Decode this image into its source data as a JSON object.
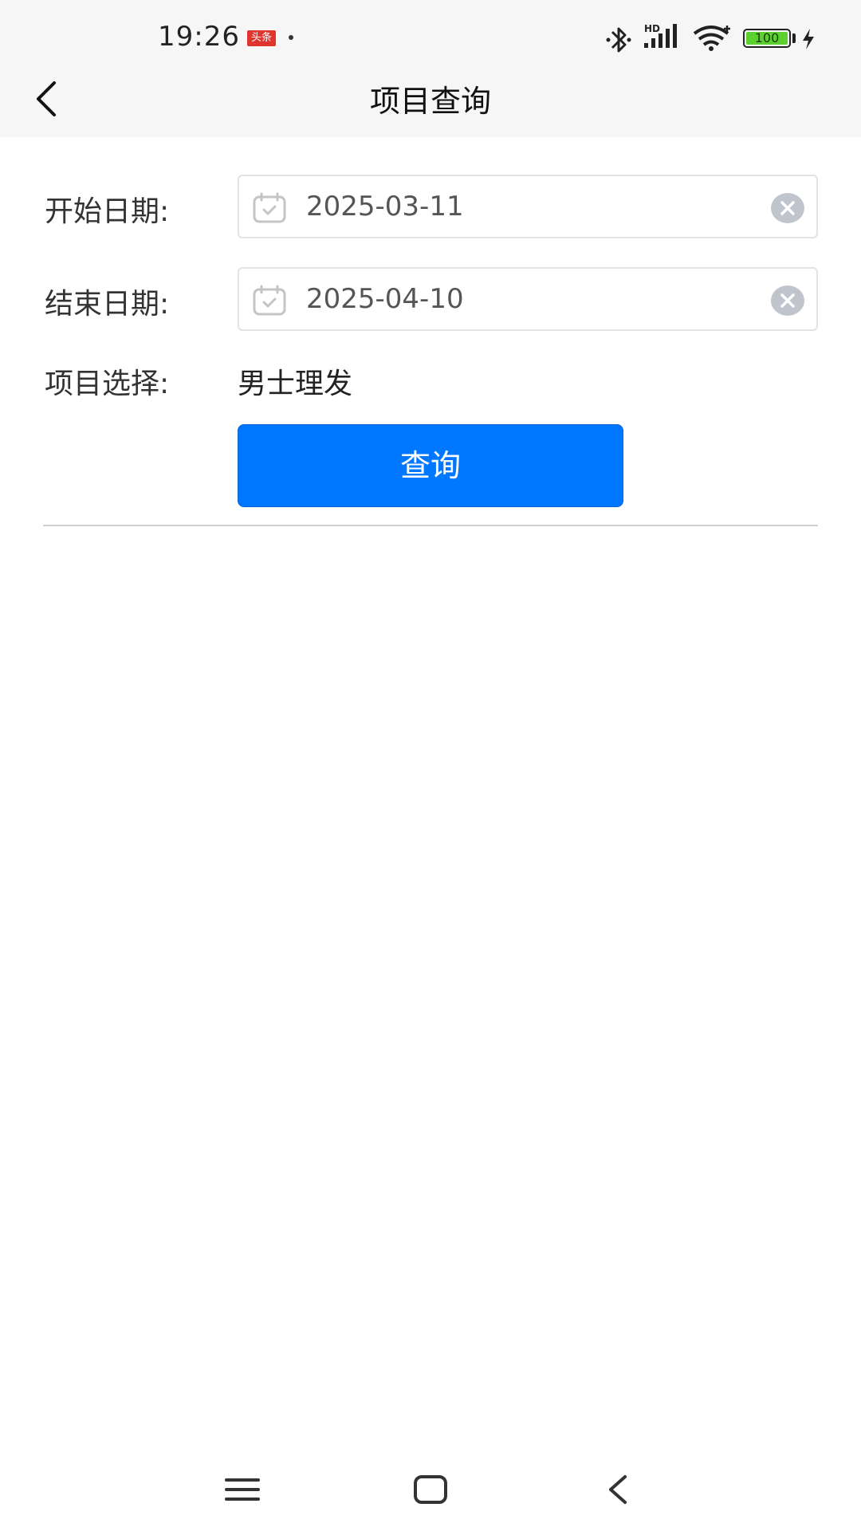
{
  "status_bar": {
    "time": "19:26",
    "news_badge": "头条",
    "battery_level": "100",
    "icons": [
      "bluetooth-icon",
      "hd-signal-icon",
      "wifi-icon",
      "battery-icon",
      "charging-icon"
    ]
  },
  "header": {
    "title": "项目查询",
    "back_icon": "chevron-left-icon"
  },
  "form": {
    "start_date_label": "开始日期:",
    "start_date_value": "2025-03-11",
    "end_date_label": "结束日期:",
    "end_date_value": "2025-04-10",
    "project_label": "项目选择:",
    "project_value": "男士理发",
    "query_button_label": "查询"
  },
  "colors": {
    "primary": "#0077ff",
    "header_bg": "#f6f6f6",
    "battery": "#5bd02f",
    "news_badge": "#e0342f"
  },
  "navbar": {
    "icons": [
      "menu-icon",
      "home-icon",
      "back-icon"
    ]
  }
}
